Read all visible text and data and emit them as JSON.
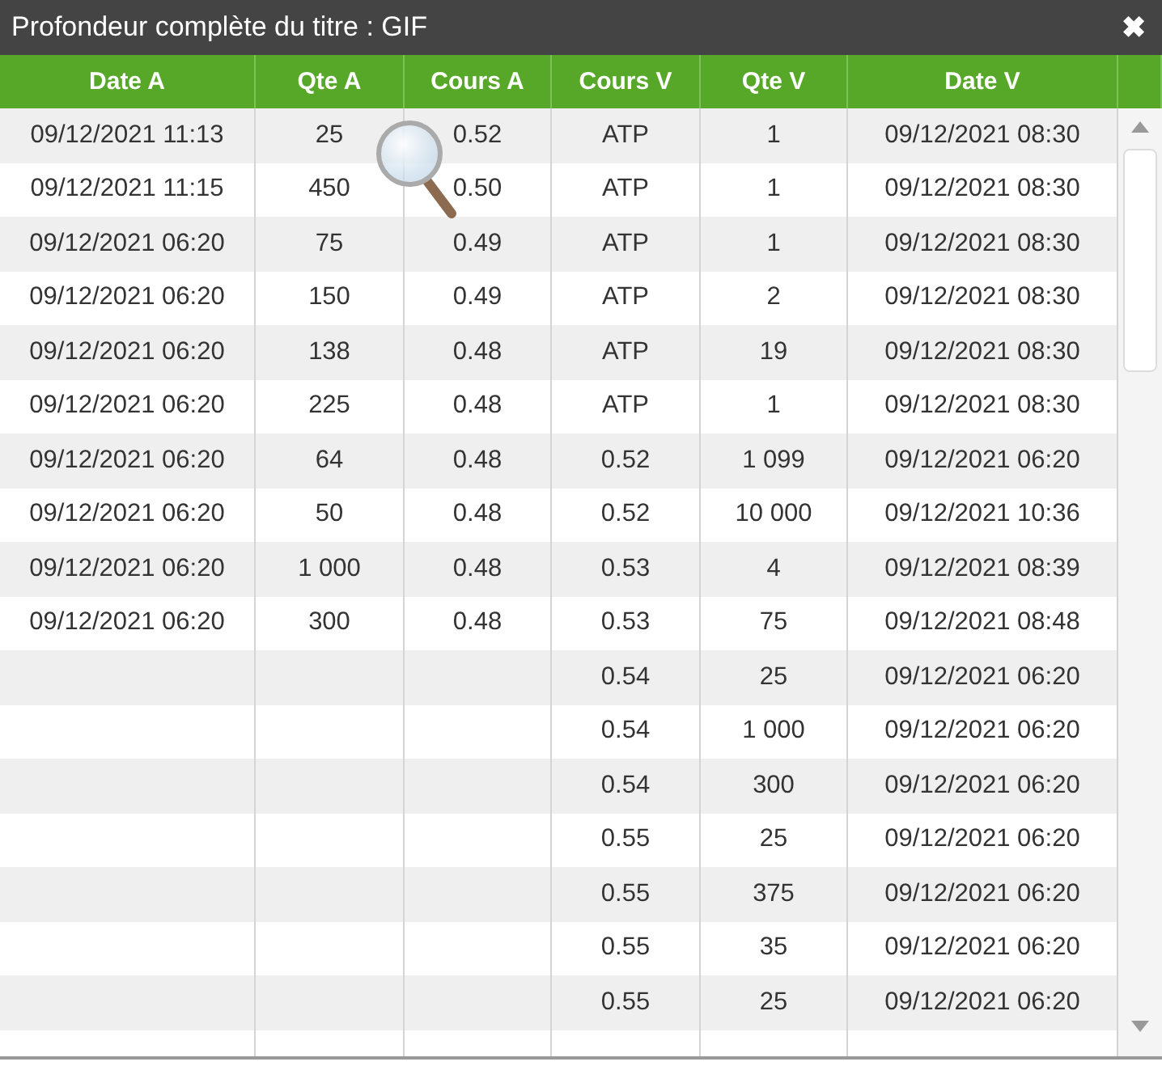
{
  "window": {
    "title": "Profondeur complète du titre : GIF",
    "close": "✖"
  },
  "table": {
    "columns": [
      "Date A",
      "Qte A",
      "Cours A",
      "Cours V",
      "Qte V",
      "Date V"
    ],
    "rows": [
      {
        "cells": [
          "09/12/2021 11:13",
          "25",
          "0.52",
          "ATP",
          "1",
          "09/12/2021 08:30"
        ]
      },
      {
        "cells": [
          "09/12/2021 11:15",
          "450",
          "0.50",
          "ATP",
          "1",
          "09/12/2021 08:30"
        ]
      },
      {
        "cells": [
          "09/12/2021 06:20",
          "75",
          "0.49",
          "ATP",
          "1",
          "09/12/2021 08:30"
        ]
      },
      {
        "cells": [
          "09/12/2021 06:20",
          "150",
          "0.49",
          "ATP",
          "2",
          "09/12/2021 08:30"
        ]
      },
      {
        "cells": [
          "09/12/2021 06:20",
          "138",
          "0.48",
          "ATP",
          "19",
          "09/12/2021 08:30"
        ]
      },
      {
        "cells": [
          "09/12/2021 06:20",
          "225",
          "0.48",
          "ATP",
          "1",
          "09/12/2021 08:30"
        ]
      },
      {
        "cells": [
          "09/12/2021 06:20",
          "64",
          "0.48",
          "0.52",
          "1 099",
          "09/12/2021 06:20"
        ]
      },
      {
        "cells": [
          "09/12/2021 06:20",
          "50",
          "0.48",
          "0.52",
          "10 000",
          "09/12/2021 10:36"
        ]
      },
      {
        "cells": [
          "09/12/2021 06:20",
          "1 000",
          "0.48",
          "0.53",
          "4",
          "09/12/2021 08:39"
        ]
      },
      {
        "cells": [
          "09/12/2021 06:20",
          "300",
          "0.48",
          "0.53",
          "75",
          "09/12/2021 08:48"
        ]
      },
      {
        "cells": [
          null,
          null,
          null,
          "0.54",
          "25",
          "09/12/2021 06:20"
        ]
      },
      {
        "cells": [
          null,
          null,
          null,
          "0.54",
          "1 000",
          "09/12/2021 06:20"
        ]
      },
      {
        "cells": [
          null,
          null,
          null,
          "0.54",
          "300",
          "09/12/2021 06:20"
        ]
      },
      {
        "cells": [
          null,
          null,
          null,
          "0.55",
          "25",
          "09/12/2021 06:20"
        ]
      },
      {
        "cells": [
          null,
          null,
          null,
          "0.55",
          "375",
          "09/12/2021 06:20"
        ]
      },
      {
        "cells": [
          null,
          null,
          null,
          "0.55",
          "35",
          "09/12/2021 06:20"
        ]
      },
      {
        "cells": [
          null,
          null,
          null,
          "0.55",
          "25",
          "09/12/2021 06:20"
        ]
      }
    ]
  }
}
